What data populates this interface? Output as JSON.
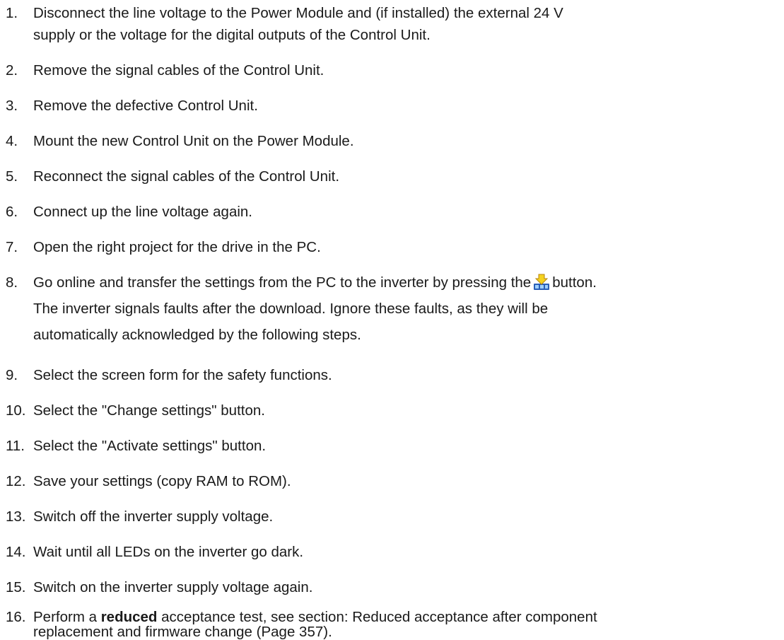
{
  "steps": [
    {
      "number": "1.",
      "lines": [
        "Disconnect the line voltage to the Power Module and (if installed) the external 24 V",
        "supply or the voltage for the digital outputs of the Control Unit."
      ]
    },
    {
      "number": "2.",
      "lines": [
        "Remove the signal cables of the Control Unit."
      ]
    },
    {
      "number": "3.",
      "lines": [
        "Remove the defective Control Unit."
      ]
    },
    {
      "number": "4.",
      "lines": [
        "Mount the new Control Unit on the Power Module."
      ]
    },
    {
      "number": "5.",
      "lines": [
        "Reconnect the signal cables of the Control Unit."
      ]
    },
    {
      "number": "6.",
      "lines": [
        "Connect up the line voltage again."
      ]
    },
    {
      "number": "7.",
      "lines": [
        "Open the right project for the drive in the PC."
      ]
    },
    {
      "number": "8.",
      "line1_before": "Go online and transfer the settings from the PC to the inverter by pressing the",
      "line1_after": "button.",
      "icon": "download-to-device-icon",
      "lines_rest": [
        "The inverter signals faults after the download. Ignore these faults, as they will be",
        "automatically acknowledged by the following steps."
      ]
    },
    {
      "number": "9.",
      "lines": [
        "Select the screen form for the safety functions."
      ]
    },
    {
      "number": "10.",
      "lines": [
        "Select the \"Change settings\" button."
      ]
    },
    {
      "number": "11.",
      "lines": [
        "Select the \"Activate settings\" button."
      ]
    },
    {
      "number": "12.",
      "lines": [
        "Save your settings (copy RAM to ROM)."
      ]
    },
    {
      "number": "13.",
      "lines": [
        "Switch off the inverter supply voltage."
      ]
    },
    {
      "number": "14.",
      "lines": [
        "Wait until all LEDs on the inverter go dark."
      ]
    },
    {
      "number": "15.",
      "lines": [
        "Switch on the inverter supply voltage again."
      ]
    },
    {
      "number": "16.",
      "line1_before": "Perform a",
      "line1_bold": "reduced",
      "line1_after": "acceptance test, see section: Reduced acceptance after component",
      "lines_rest": [
        "replacement and firmware change (Page 357)."
      ]
    }
  ]
}
